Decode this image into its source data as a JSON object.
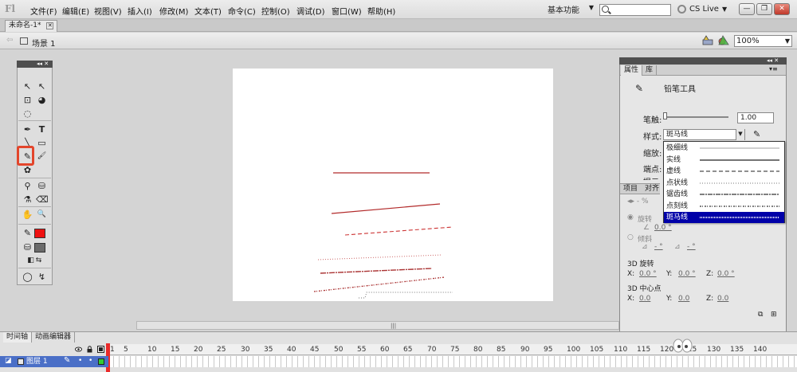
{
  "app": {
    "logo": "Fl",
    "menus": [
      "文件(F)",
      "编辑(E)",
      "视图(V)",
      "插入(I)",
      "修改(M)",
      "文本(T)",
      "命令(C)",
      "控制(O)",
      "调试(D)",
      "窗口(W)",
      "帮助(H)"
    ],
    "workspace": "基本功能",
    "search_placeholder": "",
    "cs_live": "CS Live",
    "window_buttons": [
      "—",
      "❐",
      "✕"
    ]
  },
  "document": {
    "tab_title": "未命名-1*",
    "tab_close": "✕",
    "scene": "场景 1",
    "zoom": "100%"
  },
  "icons": {
    "back": "back-arrow-icon",
    "scene": "scene-clapper-icon",
    "edit_scene": "edit-scene-icon",
    "edit_symbol": "edit-symbol-icon",
    "search": "search-icon",
    "cs_live": "cs-live-icon"
  },
  "toolbox": {
    "header_controls": "◂◂ ✕",
    "tools": [
      {
        "name": "selection",
        "glyph": "↖"
      },
      {
        "name": "subselection",
        "glyph": "↖"
      },
      {
        "name": "free-transform",
        "glyph": "⊡"
      },
      {
        "name": "3d-rotation",
        "glyph": "◕"
      },
      {
        "name": "lasso",
        "glyph": "◌"
      },
      {
        "name": "pen",
        "glyph": "✒"
      },
      {
        "name": "text",
        "glyph": "T"
      },
      {
        "name": "line",
        "glyph": "╲"
      },
      {
        "name": "rectangle",
        "glyph": "▭"
      },
      {
        "name": "pencil",
        "glyph": "✎"
      },
      {
        "name": "brush",
        "glyph": "🖌"
      },
      {
        "name": "deco",
        "glyph": "✿"
      },
      {
        "name": "bone",
        "glyph": "⚲"
      },
      {
        "name": "paint-bucket",
        "glyph": "⛁"
      },
      {
        "name": "eyedropper",
        "glyph": "⚗"
      },
      {
        "name": "eraser",
        "glyph": "⌫"
      },
      {
        "name": "hand",
        "glyph": "✋"
      },
      {
        "name": "zoom",
        "glyph": "🔍"
      },
      {
        "name": "stroke-color",
        "glyph": "✎"
      },
      {
        "name": "fill-color",
        "glyph": "⛁"
      },
      {
        "name": "black-white",
        "glyph": "◧"
      },
      {
        "name": "swap-colors",
        "glyph": "⇆"
      },
      {
        "name": "snap",
        "glyph": "◯"
      },
      {
        "name": "smooth",
        "glyph": "↯"
      }
    ],
    "stroke_color": "#ee1111",
    "fill_color": "#6a6a6a",
    "active_tool": "pencil"
  },
  "stage": {
    "background": "#ffffff",
    "line_color": "#b22a2a"
  },
  "properties": {
    "header_controls": "◂◂ ✕",
    "tabs": [
      "属性",
      "库"
    ],
    "menu": "▾≡",
    "tool_name": "铅笔工具",
    "stroke_label": "笔触:",
    "stroke_value": "1.00",
    "style_label": "样式:",
    "style_value": "斑马线",
    "scale_label": "缩放:",
    "cap_label": "端点:",
    "hint_label": "提示:",
    "style_options": [
      {
        "label": "极细线",
        "kind": "hairline"
      },
      {
        "label": "实线",
        "kind": "solid"
      },
      {
        "label": "虚线",
        "kind": "dashed"
      },
      {
        "label": "点状线",
        "kind": "dotted"
      },
      {
        "label": "锯齿线",
        "kind": "ragged"
      },
      {
        "label": "点刻线",
        "kind": "stipple"
      },
      {
        "label": "斑马线",
        "kind": "hatched",
        "selected": true
      }
    ],
    "lower_tabs": [
      "项目",
      "对齐"
    ],
    "flow_row": "◂▸ - %",
    "rotate_label": "旋转",
    "rotate_value": "0.0 °",
    "skew_label": "倾斜",
    "skew_value1": "- °",
    "skew_value2": "- °",
    "rotate3d_label": "3D 旋转",
    "center3d_label": "3D 中心点",
    "x_label": "X:",
    "y_label": "Y:",
    "z_label": "Z:",
    "coord_value": "0.0 °",
    "center_value": "0.0",
    "footer_icons": [
      "⧉",
      "⊞"
    ]
  },
  "timeline": {
    "tabs": [
      "时间轴",
      "动画编辑器"
    ],
    "header_icons": [
      "eye-icon",
      "lock-icon",
      "outline-icon"
    ],
    "frame_numbers": [
      "1",
      "5",
      "10",
      "15",
      "20",
      "25",
      "30",
      "35",
      "40",
      "45",
      "50",
      "55",
      "60",
      "65",
      "70",
      "75",
      "80",
      "85",
      "90",
      "95",
      "100",
      "105",
      "110",
      "115",
      "120",
      "125",
      "130",
      "135",
      "140"
    ],
    "layer_name": "图层 1",
    "layer_dots": [
      "•",
      "•"
    ],
    "layer_color": "#33cc33"
  }
}
